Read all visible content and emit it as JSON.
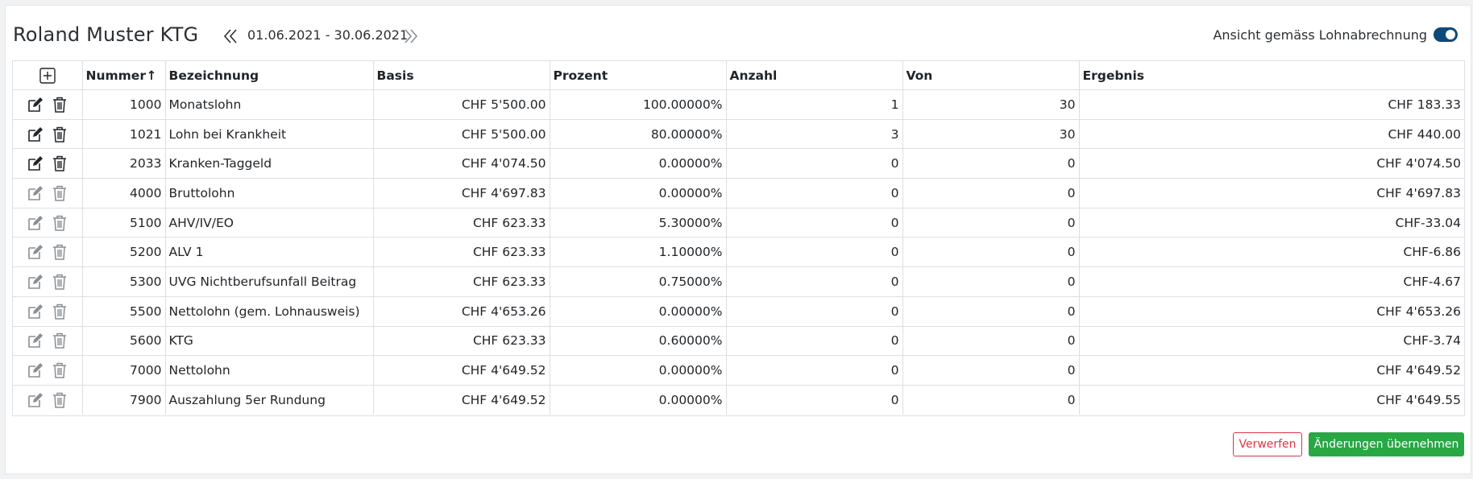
{
  "header": {
    "title": "Roland Muster KTG",
    "date_range": "01.06.2021 - 30.06.2021",
    "view_toggle_label": "Ansicht gemäss Lohnabrechnung",
    "view_toggle_on": true
  },
  "table": {
    "columns": {
      "nummer": "Nummer",
      "bezeichnung": "Bezeichnung",
      "basis": "Basis",
      "prozent": "Prozent",
      "anzahl": "Anzahl",
      "von": "Von",
      "ergebnis": "Ergebnis"
    },
    "sort_icon": "arrow-up-icon",
    "rows": [
      {
        "nummer": "1000",
        "bezeichnung": "Monatslohn",
        "basis": "CHF 5'500.00",
        "prozent": "100.00000%",
        "anzahl": "1",
        "von": "30",
        "ergebnis": "CHF 183.33",
        "editable": true
      },
      {
        "nummer": "1021",
        "bezeichnung": "Lohn bei Krankheit",
        "basis": "CHF 5'500.00",
        "prozent": "80.00000%",
        "anzahl": "3",
        "von": "30",
        "ergebnis": "CHF 440.00",
        "editable": true
      },
      {
        "nummer": "2033",
        "bezeichnung": "Kranken-Taggeld",
        "basis": "CHF 4'074.50",
        "prozent": "0.00000%",
        "anzahl": "0",
        "von": "0",
        "ergebnis": "CHF 4'074.50",
        "editable": true
      },
      {
        "nummer": "4000",
        "bezeichnung": "Bruttolohn",
        "basis": "CHF 4'697.83",
        "prozent": "0.00000%",
        "anzahl": "0",
        "von": "0",
        "ergebnis": "CHF 4'697.83",
        "editable": false
      },
      {
        "nummer": "5100",
        "bezeichnung": "AHV/IV/EO",
        "basis": "CHF 623.33",
        "prozent": "5.30000%",
        "anzahl": "0",
        "von": "0",
        "ergebnis": "CHF-33.04",
        "editable": false
      },
      {
        "nummer": "5200",
        "bezeichnung": "ALV 1",
        "basis": "CHF 623.33",
        "prozent": "1.10000%",
        "anzahl": "0",
        "von": "0",
        "ergebnis": "CHF-6.86",
        "editable": false
      },
      {
        "nummer": "5300",
        "bezeichnung": "UVG Nichtberufsunfall Beitrag",
        "basis": "CHF 623.33",
        "prozent": "0.75000%",
        "anzahl": "0",
        "von": "0",
        "ergebnis": "CHF-4.67",
        "editable": false
      },
      {
        "nummer": "5500",
        "bezeichnung": "Nettolohn (gem. Lohnausweis)",
        "basis": "CHF 4'653.26",
        "prozent": "0.00000%",
        "anzahl": "0",
        "von": "0",
        "ergebnis": "CHF 4'653.26",
        "editable": false
      },
      {
        "nummer": "5600",
        "bezeichnung": "KTG",
        "basis": "CHF 623.33",
        "prozent": "0.60000%",
        "anzahl": "0",
        "von": "0",
        "ergebnis": "CHF-3.74",
        "editable": false
      },
      {
        "nummer": "7000",
        "bezeichnung": "Nettolohn",
        "basis": "CHF 4'649.52",
        "prozent": "0.00000%",
        "anzahl": "0",
        "von": "0",
        "ergebnis": "CHF 4'649.52",
        "editable": false
      },
      {
        "nummer": "7900",
        "bezeichnung": "Auszahlung 5er Rundung",
        "basis": "CHF 4'649.52",
        "prozent": "0.00000%",
        "anzahl": "0",
        "von": "0",
        "ergebnis": "CHF 4'649.55",
        "editable": false
      }
    ]
  },
  "footer": {
    "discard_label": "Verwerfen",
    "apply_label": "Änderungen übernehmen"
  },
  "colors": {
    "icon_active": "#212529",
    "icon_inactive": "#8a8f94",
    "toggle": "#0d4a7a",
    "discard": "#dc3545",
    "apply": "#28a745"
  }
}
